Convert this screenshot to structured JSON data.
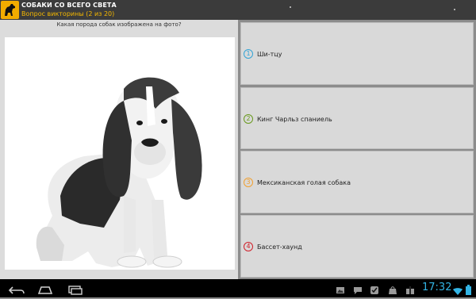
{
  "app": {
    "title": "СОБАКИ СО ВСЕГО СВЕТА",
    "subtitle": "Вопрос викторины (2 из 20)",
    "icon": "dog-icon"
  },
  "question": {
    "text": "Какая порода собак изображена на фото?",
    "image": "basset-hound-puppy-photo"
  },
  "answers": [
    {
      "number": "1",
      "label": "Ши-тцу",
      "color": "#33a4d6"
    },
    {
      "number": "2",
      "label": "Кинг Чарльз спаниель",
      "color": "#6a9a1f"
    },
    {
      "number": "3",
      "label": "Мексиканская голая собака",
      "color": "#f0a030"
    },
    {
      "number": "4",
      "label": "Бассет-хаунд",
      "color": "#d0202a"
    }
  ],
  "status_bar": {
    "time": "17:32",
    "icons": [
      "gallery-icon",
      "chat-icon",
      "check-icon",
      "bag-icon",
      "gift-icon",
      "wifi-icon",
      "battery-icon"
    ]
  },
  "nav": {
    "buttons": [
      "back-icon",
      "home-icon",
      "recents-icon"
    ]
  },
  "colors": {
    "action_bar": "#3b3b3b",
    "subtitle": "#f5b800",
    "clock": "#33b5e5"
  }
}
